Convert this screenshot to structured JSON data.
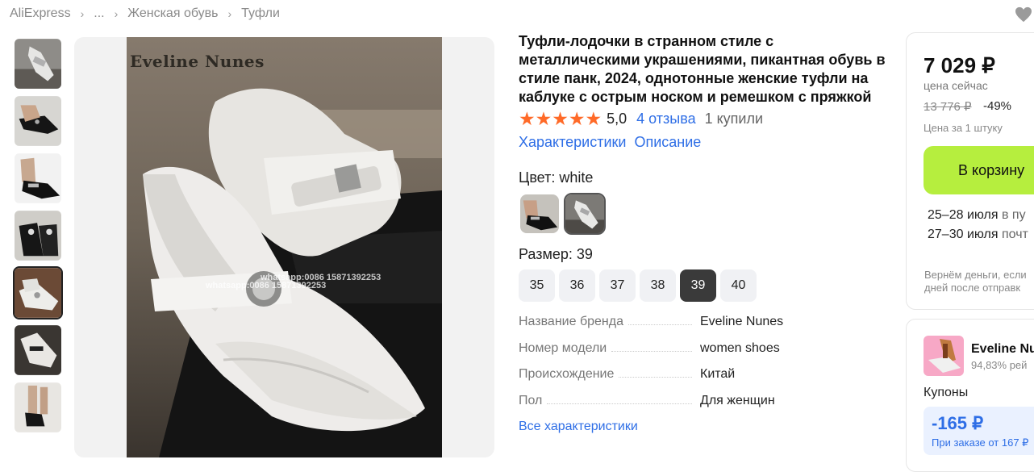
{
  "breadcrumb": {
    "items": [
      "AliExpress",
      "...",
      "Женская обувь",
      "Туфли"
    ]
  },
  "icons": {
    "favorite": "heart-icon",
    "separator": "chevron-right-icon",
    "star": "star-icon"
  },
  "gallery": {
    "thumbnail_count": 7,
    "active_index": 4,
    "watermark_brand": "Eveline Nunes",
    "watermark_contact_1": "whatsapp:0086 15871392253",
    "watermark_contact_2": "whatsapp:0086 15871392253"
  },
  "product": {
    "title": "Туфли-лодочки в странном стиле с металлическими украшениями, пикантная обувь в стиле панк, 2024, однотонные женские туфли на каблуке с острым носком и ремешком с пряжкой",
    "rating": "5,0",
    "stars": 5,
    "reviews": "4 отзыва",
    "bought": "1 купили",
    "tabs": [
      "Характеристики",
      "Описание"
    ],
    "color_label": "Цвет: white",
    "size_label": "Размер: 39",
    "sizes": [
      "35",
      "36",
      "37",
      "38",
      "39",
      "40"
    ],
    "selected_size": "39",
    "specs": [
      {
        "key": "Название бренда",
        "value": "Eveline Nunes"
      },
      {
        "key": "Номер модели",
        "value": "women shoes"
      },
      {
        "key": "Происхождение",
        "value": "Китай"
      },
      {
        "key": "Пол",
        "value": "Для женщин"
      }
    ],
    "all_specs_link": "Все характеристики"
  },
  "buy": {
    "price": "7 029 ₽",
    "price_note": "цена сейчас",
    "old_price": "13 776 ₽",
    "discount": "-49%",
    "per_unit": "Цена за 1 штуку",
    "cart_button": "В корзину",
    "delivery_1_date": "25–28 июля",
    "delivery_1_method": "в пу",
    "delivery_2_date": "27–30 июля",
    "delivery_2_method": "почт",
    "refund_line_1": "Вернём деньги, если",
    "refund_line_2": "дней после отправк",
    "accent_color": "#b6ee3e",
    "link_color": "#2e6ee6",
    "star_color": "#ff6a28"
  },
  "seller": {
    "name": "Eveline Nu",
    "rating": "94,83% рей",
    "coupons_label": "Купоны",
    "coupon_amount": "-165 ₽",
    "coupon_condition": "При заказе от 167 ₽"
  }
}
